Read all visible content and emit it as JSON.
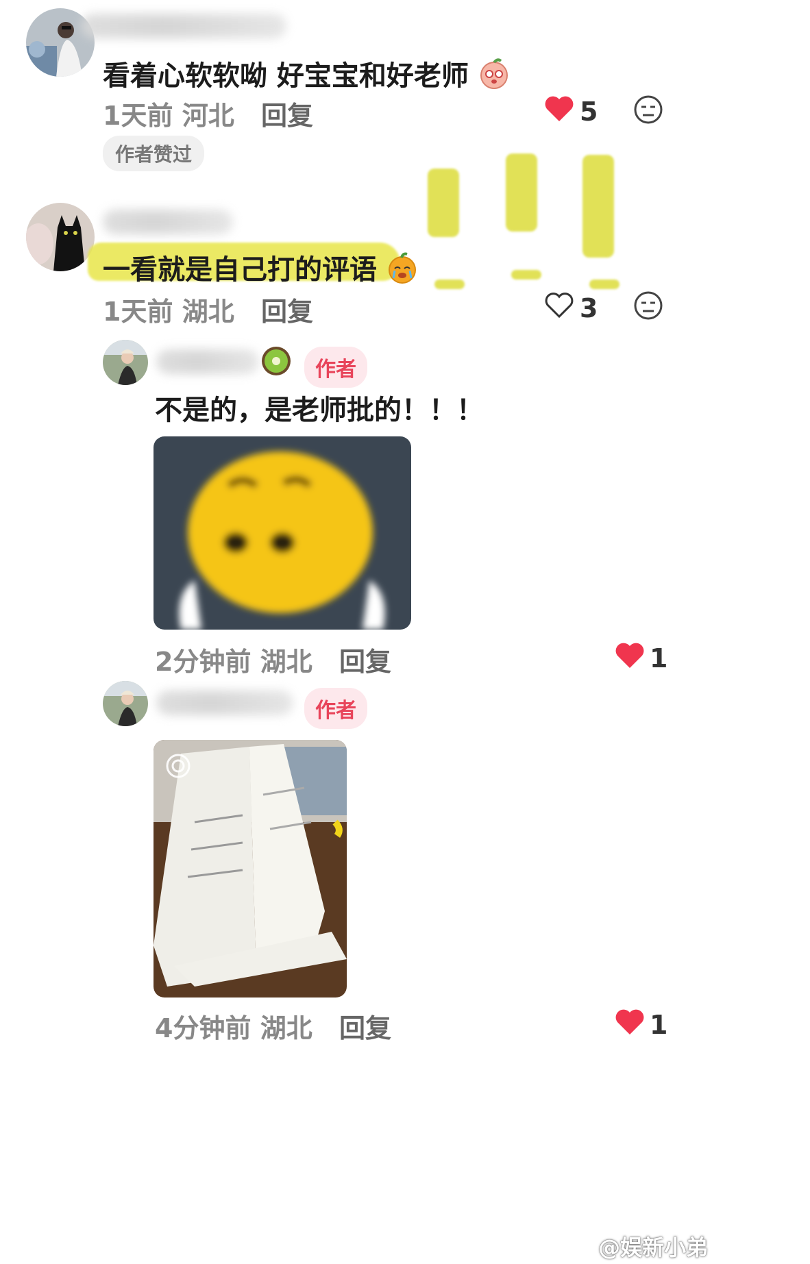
{
  "comments": [
    {
      "text": "看着心软软呦 好宝宝和好老师",
      "time": "1天前",
      "location": "河北",
      "reply_label": "回复",
      "likes": "5",
      "liked": true,
      "badge": "作者赞过"
    },
    {
      "text": "一看就是自己打的评语",
      "time": "1天前",
      "location": "湖北",
      "reply_label": "回复",
      "likes": "3",
      "liked": false
    }
  ],
  "replies": [
    {
      "tag": "作者",
      "text": "不是的，是老师批的！！！",
      "time": "2分钟前",
      "location": "湖北",
      "reply_label": "回复",
      "likes": "1"
    },
    {
      "tag": "作者",
      "time": "4分钟前",
      "location": "湖北",
      "reply_label": "回复",
      "likes": "1"
    }
  ],
  "watermark": "@娱新小弟",
  "colors": {
    "like_red": "#f0354e",
    "author_tag_bg": "#fde8ec",
    "author_tag_text": "#e8445a",
    "highlight_yellow": "#e8e64a"
  }
}
